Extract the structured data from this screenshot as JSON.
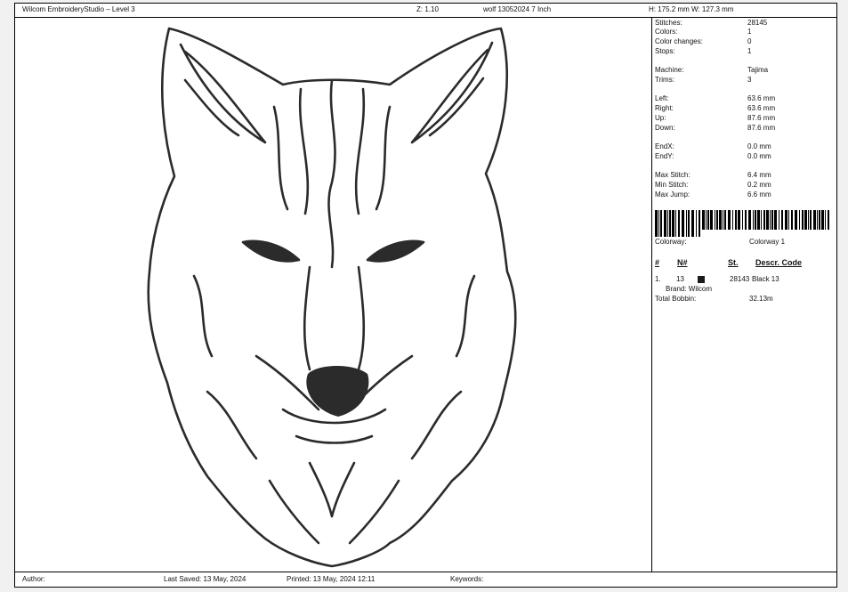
{
  "header": {
    "app": "Wilcom EmbroideryStudio – Level 3",
    "zoom": "Z: 1.10",
    "file": "wolf 13052024 7  Inch",
    "size": "H: 175.2 mm   W: 127.3 mm"
  },
  "stats": [
    {
      "label": "Stitches:",
      "value": "28145"
    },
    {
      "label": "Colors:",
      "value": "1"
    },
    {
      "label": "Color changes:",
      "value": "0"
    },
    {
      "label": "Stops:",
      "value": "1"
    },
    {
      "label": "Machine:",
      "value": "Tajima"
    },
    {
      "label": "Trims:",
      "value": "3"
    },
    {
      "label": "Left:",
      "value": "63.6 mm"
    },
    {
      "label": "Right:",
      "value": "63.6 mm"
    },
    {
      "label": "Up:",
      "value": "87.6 mm"
    },
    {
      "label": "Down:",
      "value": "87.6 mm"
    },
    {
      "label": "EndX:",
      "value": "0.0 mm"
    },
    {
      "label": "EndY:",
      "value": "0.0 mm"
    },
    {
      "label": "Max Stitch:",
      "value": "6.4 mm"
    },
    {
      "label": "Min Stitch:",
      "value": "0.2 mm"
    },
    {
      "label": "Max Jump:",
      "value": "6.6 mm"
    }
  ],
  "colorway": {
    "label": "Colorway:",
    "value": "Colorway 1"
  },
  "table": {
    "headers": [
      "#",
      "N#",
      "St.",
      "Descr. Code"
    ],
    "rows": [
      {
        "index": "1.",
        "n": "13",
        "swatch": "#1a1a1a",
        "st": "28143",
        "descr": "Black 13"
      }
    ],
    "brand": "Brand: Wilcom",
    "total_bobbin_label": "Total Bobbin:",
    "total_bobbin_value": "32.13m"
  },
  "footer": {
    "author": "Author:",
    "last_saved": "Last Saved:  13 May, 2024",
    "printed": "Printed:  13 May, 2024 12:11",
    "keywords": "Keywords:"
  }
}
